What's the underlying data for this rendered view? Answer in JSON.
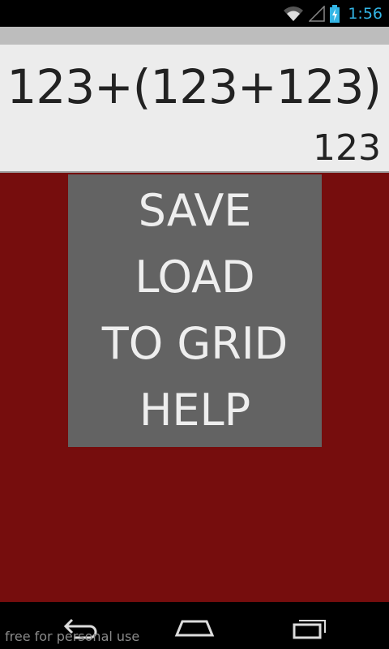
{
  "status_bar": {
    "time": "1:56",
    "icons": [
      "wifi-icon",
      "signal-icon",
      "battery-charging-icon"
    ],
    "accent_color": "#33b5e5"
  },
  "display": {
    "expression": "123+(123+123)",
    "result": "123"
  },
  "menu": {
    "items": [
      "SAVE",
      "LOAD",
      "TO GRID",
      "HELP"
    ]
  },
  "nav_bar": {
    "icons": [
      "back-icon",
      "home-icon",
      "recent-apps-icon"
    ]
  },
  "watermark": "free for personal use",
  "colors": {
    "background": "#760d0d",
    "menu_background": "#636363",
    "display_background": "#ececec"
  }
}
